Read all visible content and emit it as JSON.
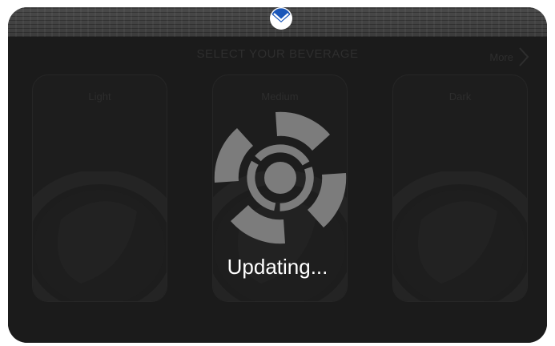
{
  "header": {
    "title": "SELECT YOUR BEVERAGE",
    "more_label": "More"
  },
  "cards": [
    {
      "label": "Light"
    },
    {
      "label": "Medium"
    },
    {
      "label": "Dark"
    }
  ],
  "overlay": {
    "status_text": "Updating..."
  },
  "icons": {
    "badge": "brand-badge-icon",
    "spinner": "spinner-logo-icon",
    "more": "chevron-right-icon"
  },
  "colors": {
    "badge_blue": "#1b57b9",
    "overlay_bg": "#1b1b1b",
    "status_text": "#ffffff"
  }
}
